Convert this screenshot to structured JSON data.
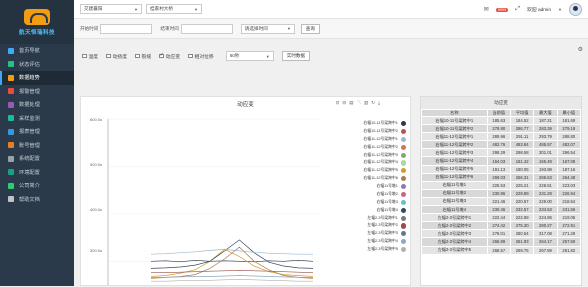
{
  "brand": "航天恒瑞科技",
  "sidebar": {
    "items": [
      {
        "label": "首页导航",
        "color": "#3fa9f5"
      },
      {
        "label": "状态评估",
        "color": "#26c281"
      },
      {
        "label": "数据趋势",
        "color": "#f39c12"
      },
      {
        "label": "报警管理",
        "color": "#e74c3c"
      },
      {
        "label": "数据处理",
        "color": "#9b59b6"
      },
      {
        "label": "采样监测",
        "color": "#1abc9c"
      },
      {
        "label": "报表管理",
        "color": "#3498db"
      },
      {
        "label": "账号管理",
        "color": "#e67e22"
      },
      {
        "label": "系统配置",
        "color": "#95a5a6"
      },
      {
        "label": "环境配置",
        "color": "#16a085"
      },
      {
        "label": "公司简介",
        "color": "#2ecc71"
      },
      {
        "label": "帮助文档",
        "color": "#bdc3c7"
      }
    ],
    "active_index": 2
  },
  "topbar": {
    "select1": "交建襄阳",
    "select2": "桂家村大桥",
    "badge": "9999",
    "welcome": "欢迎 admin"
  },
  "filter": {
    "start_label": "开始时间",
    "end_label": "结束时间",
    "range_select": "请选择时间",
    "query_button": "查询"
  },
  "options": {
    "items": [
      {
        "label": "温度",
        "checked": false
      },
      {
        "label": "动挠度",
        "checked": false
      },
      {
        "label": "裂缝",
        "checked": false
      },
      {
        "label": "动应变",
        "checked": true
      },
      {
        "label": "相对位移",
        "checked": false
      }
    ],
    "interval": "60秒",
    "realtime_button": "实时数据"
  },
  "chart": {
    "title": "动应变",
    "y_ticks": [
      "600.0u",
      "500.0u",
      "400.0u",
      "300.0u"
    ],
    "toolbox": [
      "zoom-icon",
      "zoom-reset-icon",
      "data-view-icon",
      "line-icon",
      "bar-icon",
      "restore-icon",
      "save-icon"
    ]
  },
  "legend": [
    {
      "name": "右幅10-11号梁跨中1",
      "color": "#2b3a4a"
    },
    {
      "name": "右幅10-11号梁跨中2",
      "color": "#c0504d"
    },
    {
      "name": "右幅11-12号梁跨中1",
      "color": "#9ab7cf"
    },
    {
      "name": "右幅11-12号梁跨中2",
      "color": "#d17847"
    },
    {
      "name": "右幅11-12号梁跨中3",
      "color": "#7fa97a"
    },
    {
      "name": "右幅11-12号梁跨中4",
      "color": "#aed6a2"
    },
    {
      "name": "右幅11-12号梁跨中5",
      "color": "#d79b29"
    },
    {
      "name": "右幅11-12号梁跨中6",
      "color": "#a87c56"
    },
    {
      "name": "右幅11号墩1",
      "color": "#8a7ab8"
    },
    {
      "name": "右幅11号墩2",
      "color": "#c76a7f"
    },
    {
      "name": "右幅11号墩3",
      "color": "#6ac0c6"
    },
    {
      "name": "右幅11号墩4",
      "color": "#35495e"
    },
    {
      "name": "左幅2-3号梁跨中1",
      "color": "#7b7b7b"
    },
    {
      "name": "左幅2-3号梁跨中2",
      "color": "#9a4f4a"
    },
    {
      "name": "左幅2-3号梁跨中3",
      "color": "#5f7a93"
    },
    {
      "name": "左幅2-3号梁跨中4",
      "color": "#8fa8bf"
    },
    {
      "name": "左幅2-3号梁跨中5",
      "color": "#b0b0b0"
    }
  ],
  "chart_data": {
    "type": "line",
    "title": "动应变",
    "xlabel": "",
    "ylabel": "",
    "ylim": [
      250,
      600
    ],
    "y_unit": "u",
    "legend_position": "right",
    "series": [
      {
        "name": "右幅10-11号梁跨中1",
        "values": [
          300,
          301,
          299,
          302,
          300,
          301,
          300,
          299,
          301,
          300,
          302,
          300
        ]
      },
      {
        "name": "右幅11-12号梁跨中5",
        "values": [
          268,
          270,
          275,
          282,
          300,
          325,
          310,
          290,
          278,
          272,
          270,
          268
        ]
      },
      {
        "name": "右幅11-12号梁跨中6",
        "values": [
          264,
          266,
          268,
          272,
          285,
          305,
          330,
          300,
          282,
          270,
          266,
          264
        ]
      },
      {
        "name": "右幅11号墩4",
        "values": [
          285,
          286,
          288,
          292,
          300,
          322,
          345,
          318,
          298,
          290,
          286,
          285
        ]
      },
      {
        "name": "左幅2-3号梁跨中2",
        "values": [
          276,
          276,
          277,
          278,
          279,
          280,
          281,
          280,
          279,
          278,
          277,
          276
        ]
      },
      {
        "name": "左幅2-3号梁跨中4",
        "values": [
          266,
          266,
          267,
          268,
          268,
          269,
          270,
          269,
          268,
          267,
          266,
          266
        ]
      },
      {
        "name": "左幅2-3号梁跨中5",
        "values": [
          258,
          258,
          259,
          259,
          260,
          261,
          262,
          261,
          260,
          259,
          258,
          258
        ]
      },
      {
        "name": "右幅11-12号梁跨中1",
        "values": [
          315,
          316,
          318,
          320,
          323,
          325,
          322,
          319,
          317,
          316,
          315,
          315
        ]
      }
    ],
    "x_count": 12
  },
  "table": {
    "title": "动应变",
    "columns": [
      "名称",
      "当前值",
      "平均值",
      "最大值",
      "最小值"
    ],
    "rows": [
      [
        "右幅10-11号梁跨中1",
        "185.63",
        "184.52",
        "187.21",
        "181.69"
      ],
      [
        "右幅10-11号梁跨中2",
        "278.90",
        "286.77",
        "283.39",
        "279.19"
      ],
      [
        "右幅11-12号梁跨中1",
        "289.96",
        "291.11",
        "293.79",
        "288.80"
      ],
      [
        "右幅11-12号梁跨中2",
        "482.76",
        "483.84",
        "485.57",
        "482.07"
      ],
      [
        "右幅11-12号梁跨中3",
        "298.29",
        "298.58",
        "301.01",
        "296.54"
      ],
      [
        "右幅11-12号梁跨中4",
        "164.03",
        "161.42",
        "165.49",
        "167.08"
      ],
      [
        "右幅11-12号梁跨中5",
        "191.13",
        "190.05",
        "193.98",
        "187.16"
      ],
      [
        "右幅11-12号梁跨中6",
        "269.03",
        "266.31",
        "266.53",
        "264.48"
      ],
      [
        "右幅11号墩1",
        "225.53",
        "225.21",
        "226.51",
        "223.03"
      ],
      [
        "右幅11号墩2",
        "230.86",
        "229.89",
        "231.29",
        "226.94"
      ],
      [
        "右幅11号墩3",
        "221.46",
        "220.67",
        "229.00",
        "218.64"
      ],
      [
        "右幅11号墩4",
        "230.46",
        "232.57",
        "234.53",
        "231.56"
      ],
      [
        "左幅2-3号梁跨中1",
        "222.44",
        "222.89",
        "224.86",
        "219.05"
      ],
      [
        "左幅2-3号梁跨中2",
        "274.42",
        "275.30",
        "280.27",
        "272.91"
      ],
      [
        "左幅2-3号梁跨中3",
        "278.01",
        "280.54",
        "317.08",
        "271.28"
      ],
      [
        "左幅2-3号梁跨中4",
        "266.89",
        "261.93",
        "264.17",
        "257.59"
      ],
      [
        "左幅2-3号梁跨中5",
        "268.57",
        "269.75",
        "267.89",
        "261.82"
      ]
    ]
  }
}
